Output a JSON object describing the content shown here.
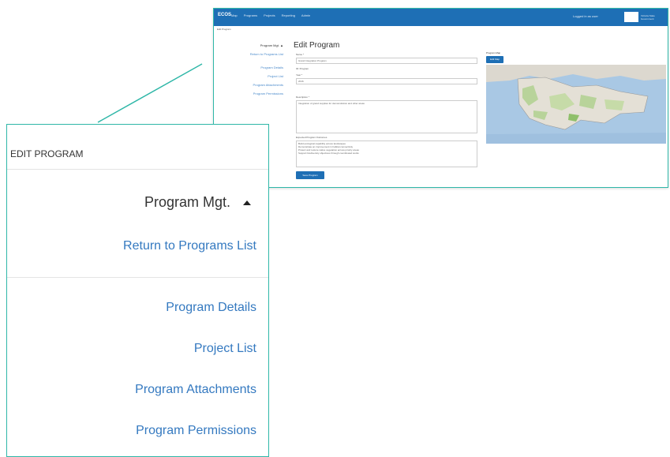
{
  "screenshot": {
    "brand": "ECOS",
    "nav": [
      "Map",
      "Programs",
      "Projects",
      "Reporting",
      "Admin"
    ],
    "user_link": "Logged in as user",
    "logo_text": "Victoria State Government",
    "breadcrumb": "Edit Program",
    "sidebar": {
      "title": "Program Mgt. ▲",
      "return": "Return to Programs List",
      "items": [
        "Program Details",
        "Project List",
        "Program Attachments",
        "Program Permissions"
      ]
    },
    "page_title": "Edit Program",
    "fields": {
      "name_label": "Name *",
      "name_value": "Grand Integration Program",
      "id_label": "ID: Program",
      "year_label": "Year *",
      "year_value": "2016",
      "description_label": "Description *",
      "description_value": "Integration of grand supplies for demonstration and other areas",
      "outcomes_label": "Expected Program Outcomes",
      "outcomes_lines": [
        "Build ecological capability across landscapes",
        "Demonstrate an improvement in habitat connectivity",
        "Protect and restore native vegetation across priority areas",
        "Support biodiversity objectives through coordinated works"
      ]
    },
    "save_button": "Save Program",
    "map_title": "Program Map",
    "map_button": "Edit Map",
    "colors": {
      "topbar": "#1e6fb5",
      "link": "#3479c0",
      "accent": "#2fb7a8"
    }
  },
  "panel": {
    "header": "EDIT PROGRAM",
    "mgt_title": "Program Mgt.",
    "return_link": "Return to Programs List",
    "links": [
      "Program Details",
      "Project List",
      "Program Attachments",
      "Program Permissions"
    ]
  }
}
